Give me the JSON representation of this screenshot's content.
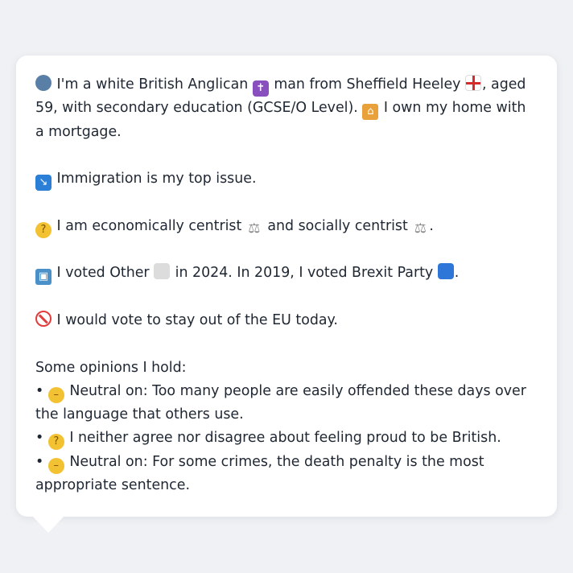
{
  "message": {
    "intro_part1": "I'm a white British Anglican",
    "intro_part2": "man from Sheffield Heeley",
    "intro_part3": ", aged 59, with secondary education (GCSE/O Level).",
    "intro_part4": "I own my home with a mortgage.",
    "top_issue": "Immigration is my top issue.",
    "ideology_part1": "I am economically centrist",
    "ideology_part2": "and socially centrist",
    "ideology_part3": ".",
    "vote_part1": "I voted Other",
    "vote_part2": "in 2024. In 2019, I voted Brexit Party",
    "vote_part3": ".",
    "eu_stance": "I would vote to stay out of the EU today.",
    "opinions_header": "Some opinions I hold:",
    "opinions": [
      {
        "bullet": "•",
        "text": "Neutral on: Too many people are easily offended these days over the language that others use."
      },
      {
        "bullet": "•",
        "text": "I neither agree nor disagree about feeling proud to be British."
      },
      {
        "bullet": "•",
        "text": "Neutral on: For some crimes, the death penalty is the most appropriate sentence."
      }
    ]
  },
  "icons": {
    "person": "person-silhouette-icon",
    "cross": "latin-cross-icon",
    "flag": "england-flag-icon",
    "house": "house-icon",
    "immigration": "passport-control-icon",
    "thinking": "thinking-face-icon",
    "scales": "balance-scale-icon",
    "ballot": "ballot-box-icon",
    "other_party": "grey-square-icon",
    "brexit_party": "blue-square-icon",
    "prohibited": "no-entry-icon",
    "neutral": "neutral-face-icon"
  },
  "colors": {
    "background": "#eff1f4",
    "bubble": "#ffffff",
    "text": "#1f2733",
    "brexit_blue": "#2f76d9",
    "other_grey": "#dcdcdc"
  }
}
